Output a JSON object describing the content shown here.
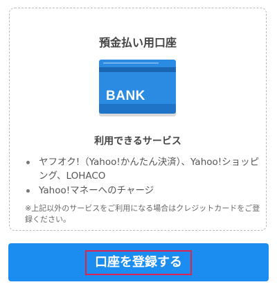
{
  "card": {
    "title": "預金払い用口座",
    "bank_label": "BANK",
    "subtitle": "利用できるサービス",
    "services": [
      "ヤフオク!（Yahoo!かんたん決済）、Yahoo!ショッピング、LOHACO",
      "Yahoo!マネーへのチャージ"
    ],
    "note": "※上記以外のサービスをご利用になる場合はクレジットカードをご登録ください。"
  },
  "button": {
    "label": "口座を登録する"
  },
  "colors": {
    "accent": "#1b8cf0",
    "bank_card": "#2b8be3",
    "highlight_border": "#e0234d"
  }
}
